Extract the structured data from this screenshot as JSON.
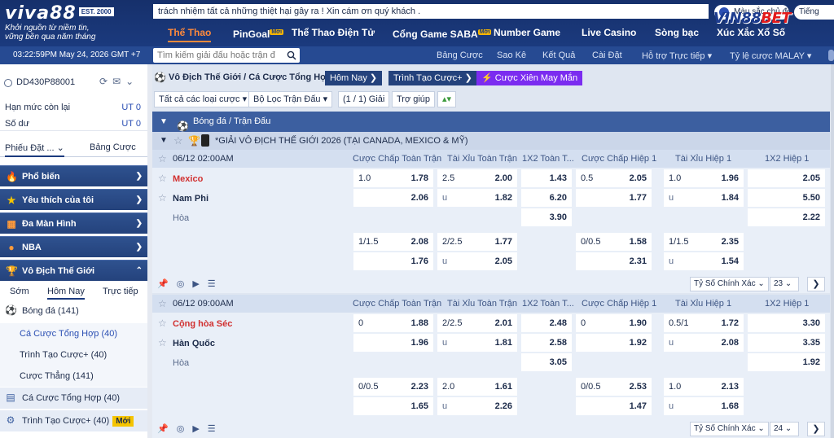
{
  "header": {
    "brand": "viva88",
    "est": "EST. 2000",
    "slogan_line1": "Khởi nguồn từ niềm tin,",
    "slogan_line2": "vững bền qua năm tháng",
    "marquee": "trách nhiệm tất cả những thiệt hại gây ra ! Xin cám ơn quý khách .",
    "color_theme": "Màu sắc chủ đề",
    "language": "Tiếng",
    "watermark_a": "VIN88",
    "watermark_b": "BET",
    "nav": [
      {
        "label": "Thể Thao",
        "active": true
      },
      {
        "label": "PinGoal",
        "badge": "Mới"
      },
      {
        "label": "Thể Thao Điện Tử"
      },
      {
        "label": "Cổng Game SABA",
        "badge": "Mới"
      },
      {
        "label": "Number Game"
      },
      {
        "label": "Live Casino"
      },
      {
        "label": "Sòng bạc"
      },
      {
        "label": "Xúc Xắc Xổ Số"
      }
    ]
  },
  "subbar": {
    "clock": "03:22:59PM May 24, 2026 GMT +7",
    "search_placeholder": "Tìm kiếm giải đấu hoặc trận đấu",
    "links": [
      "Bảng Cược",
      "Sao Kê",
      "Kết Quả",
      "Cài Đặt",
      "Hỗ trợ Trực tiếp ▾",
      "Tỷ lệ cược MALAY ▾"
    ]
  },
  "account": {
    "id": "DD430P88001",
    "limit_label": "Hạn mức còn lại",
    "limit_value": "UT 0",
    "balance_label": "Số dư",
    "balance_value": "UT 0"
  },
  "sidebar": {
    "tabs": [
      "Phiếu Đặt ...",
      "Bảng Cược"
    ],
    "menu": [
      {
        "label": "Phổ biến",
        "icon": "fire-icon"
      },
      {
        "label": "Yêu thích của tôi",
        "icon": "star-icon"
      },
      {
        "label": "Đa Màn Hình",
        "icon": "multiscreen-icon"
      },
      {
        "label": "NBA",
        "icon": "nba-icon"
      },
      {
        "label": "Vô Địch Thế Giới",
        "icon": "trophy-icon"
      }
    ],
    "period_tabs": [
      "Sớm",
      "Hôm Nay",
      "Trực tiếp"
    ],
    "sport_row": "Bóng đá",
    "sport_count": "(141)",
    "children": [
      {
        "label": "Cá Cược Tổng Hợp",
        "count": "(40)"
      },
      {
        "label": "Trình Tạo Cược+",
        "count": "(40)"
      },
      {
        "label": "Cược Thẳng",
        "count": "(141)"
      }
    ],
    "bottom": [
      {
        "label": "Cá Cược Tổng Hợp",
        "count": "(40)"
      },
      {
        "label": "Trình Tạo Cược+",
        "count": "(40)",
        "badge": "Mới"
      }
    ]
  },
  "main": {
    "crumb_title": "Vô Địch Thế Giới / Cá Cược Tổng Hợp",
    "crumb_today": "Hôm Nay",
    "crumb_builder": "Trình Tạo Cược+",
    "crumb_lucky": "Cược Xiên May Mắn",
    "filters": [
      "Tất cả các loại cược ▾",
      "Bộ Lọc Trận Đấu ▾",
      "(1 / 1) Giải",
      "Trợ giúp"
    ],
    "section": "Bóng đá / Trận Đấu",
    "league": "*GIẢI VÔ ĐỊCH THẾ GIỚI 2026 (TẠI CANADA, MEXICO & MỸ)",
    "columns": [
      "Cược Chấp Toàn Trận",
      "Tài Xỉu Toàn Trận",
      "1X2 Toàn T...",
      "Cược Chấp Hiệp 1",
      "Tài Xỉu Hiệp 1",
      "1X2 Hiệp 1"
    ],
    "draw_label": "Hòa",
    "select_label": "Tỷ Số Chính Xác",
    "matches": [
      {
        "time": "06/12 02:00AM",
        "home": "Mexico",
        "away": "Nam Phi",
        "more": "23",
        "r1": {
          "hdp_h": "1.0",
          "hdp_o": "1.78",
          "ou_h": "2.5",
          "ou_o": "2.00",
          "x12": "1.43",
          "h1hdp_h": "0.5",
          "h1hdp_o": "2.05",
          "h1ou_h": "1.0",
          "h1ou_o": "1.96",
          "h1x12": "2.05"
        },
        "r2": {
          "hdp_o": "2.06",
          "ou_h": "u",
          "ou_o": "1.82",
          "x12": "6.20",
          "h1hdp_o": "1.77",
          "h1ou_h": "u",
          "h1ou_o": "1.84",
          "h1x12": "5.50"
        },
        "r3": {
          "x12": "3.90",
          "h1x12": "2.22"
        },
        "r4": {
          "hdp_h": "1/1.5",
          "hdp_o": "2.08",
          "ou_h": "2/2.5",
          "ou_o": "1.77",
          "h1hdp_h": "0/0.5",
          "h1hdp_o": "1.58",
          "h1ou_h": "1/1.5",
          "h1ou_o": "2.35"
        },
        "r5": {
          "hdp_o": "1.76",
          "ou_h": "u",
          "ou_o": "2.05",
          "h1hdp_o": "2.31",
          "h1ou_h": "u",
          "h1ou_o": "1.54"
        }
      },
      {
        "time": "06/12 09:00AM",
        "home": "Cộng hòa Séc",
        "away": "Hàn Quốc",
        "more": "24",
        "r1": {
          "hdp_h": "0",
          "hdp_o": "1.88",
          "ou_h": "2/2.5",
          "ou_o": "2.01",
          "x12": "2.48",
          "h1hdp_h": "0",
          "h1hdp_o": "1.90",
          "h1ou_h": "0.5/1",
          "h1ou_o": "1.72",
          "h1x12": "3.30"
        },
        "r2": {
          "hdp_o": "1.96",
          "ou_h": "u",
          "ou_o": "1.81",
          "x12": "2.58",
          "h1hdp_o": "1.92",
          "h1ou_h": "u",
          "h1ou_o": "2.08",
          "h1x12": "3.35"
        },
        "r3": {
          "x12": "3.05",
          "h1x12": "1.92"
        },
        "r4": {
          "hdp_h": "0/0.5",
          "hdp_o": "2.23",
          "ou_h": "2.0",
          "ou_o": "1.61",
          "h1hdp_h": "0/0.5",
          "h1hdp_o": "2.53",
          "h1ou_h": "1.0",
          "h1ou_o": "2.13"
        },
        "r5": {
          "hdp_o": "1.65",
          "ou_h": "u",
          "ou_o": "2.26",
          "h1hdp_o": "1.47",
          "h1ou_h": "u",
          "h1ou_o": "1.68"
        }
      }
    ]
  },
  "colors": {
    "nav_bg": "#16306b",
    "active": "#ff8a3c",
    "home_team": "#d13030",
    "lucky": "#7b2cf0"
  }
}
